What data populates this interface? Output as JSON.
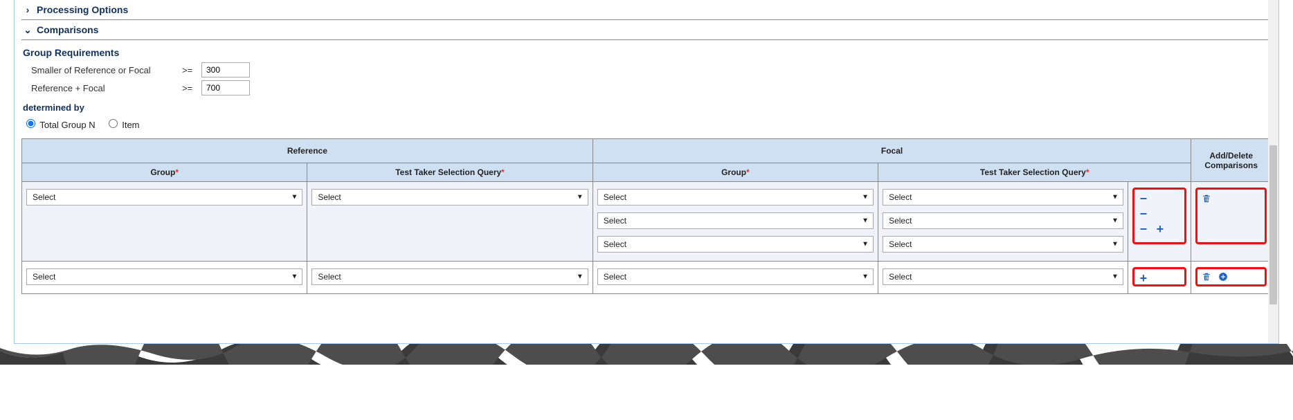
{
  "sections": {
    "processing_options": {
      "title": "Processing Options"
    },
    "comparisons": {
      "title": "Comparisons"
    }
  },
  "group_requirements": {
    "heading": "Group Requirements",
    "smaller_label": "Smaller of Reference or Focal",
    "smaller_op": ">=",
    "smaller_value": "300",
    "sum_label": "Reference + Focal",
    "sum_op": ">=",
    "sum_value": "700"
  },
  "determined_by": {
    "heading": "determined by",
    "options": [
      "Total Group N",
      "Item"
    ],
    "selected": "Total Group N"
  },
  "table": {
    "headers": {
      "reference": "Reference",
      "focal": "Focal",
      "add_delete": "Add/Delete Comparisons",
      "group": "Group",
      "tt_query": "Test Taker Selection Query"
    },
    "select_placeholder": "Select",
    "rows": [
      {
        "reference": {
          "group": "Select",
          "query": "Select"
        },
        "focal": [
          {
            "group": "Select",
            "query": "Select",
            "actions": [
              "minus"
            ]
          },
          {
            "group": "Select",
            "query": "Select",
            "actions": [
              "minus"
            ]
          },
          {
            "group": "Select",
            "query": "Select",
            "actions": [
              "minus",
              "plus"
            ]
          }
        ],
        "row_actions": [
          "trash"
        ]
      },
      {
        "reference": {
          "group": "Select",
          "query": "Select"
        },
        "focal": [
          {
            "group": "Select",
            "query": "Select",
            "actions": [
              "plus"
            ]
          }
        ],
        "row_actions": [
          "trash",
          "plus-circle"
        ]
      }
    ]
  }
}
